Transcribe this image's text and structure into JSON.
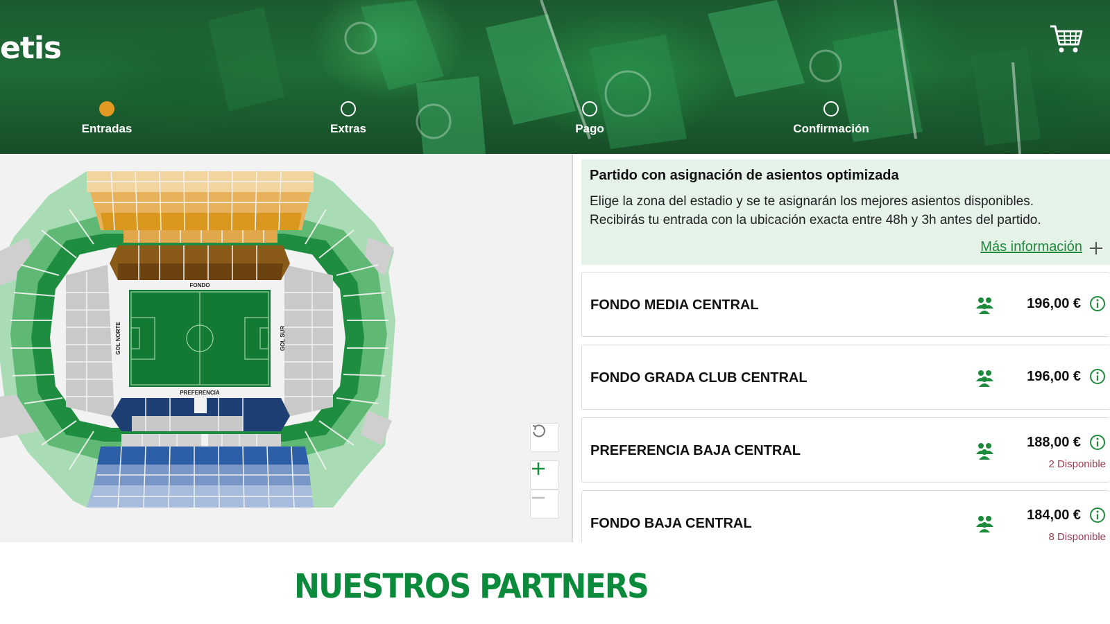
{
  "header": {
    "logo_text": "etis",
    "cart_icon": "shopping-cart-icon",
    "steps": [
      {
        "label": "Entradas",
        "active": true
      },
      {
        "label": "Extras",
        "active": false
      },
      {
        "label": "Pago",
        "active": false
      },
      {
        "label": "Confirmación",
        "active": false
      }
    ]
  },
  "stadium_map": {
    "labels": {
      "fondo": "FONDO",
      "gol_norte": "GOL NORTE",
      "gol_sur": "GOL SUR",
      "preferencia": "PREFERENCIA"
    },
    "controls": {
      "reset_icon": "reset-icon",
      "zoom_in_icon": "plus-icon",
      "zoom_out_icon": "minus-icon"
    }
  },
  "info_box": {
    "title": "Partido con asignación de asientos optimizada",
    "line1": "Elige la zona del estadio y se te asignarán los mejores asientos disponibles.",
    "line2": "Recibirás tu entrada con la ubicación exacta entre 48h y 3h antes del partido.",
    "link": "Más información"
  },
  "tickets": [
    {
      "name": "FONDO MEDIA CENTRAL",
      "price": "196,00 €",
      "availability": ""
    },
    {
      "name": "FONDO GRADA CLUB CENTRAL",
      "price": "196,00 €",
      "availability": ""
    },
    {
      "name": "PREFERENCIA BAJA CENTRAL",
      "price": "188,00 €",
      "availability": "2 Disponible"
    },
    {
      "name": "FONDO BAJA CENTRAL",
      "price": "184,00 €",
      "availability": "8 Disponible"
    }
  ],
  "footer": {
    "partners_title": "NUESTROS PARTNERS"
  },
  "colors": {
    "brand_green": "#0a8a3a",
    "active_step": "#e29a22",
    "info_bg": "#e5f2e7",
    "availability": "#9a3b4e"
  }
}
